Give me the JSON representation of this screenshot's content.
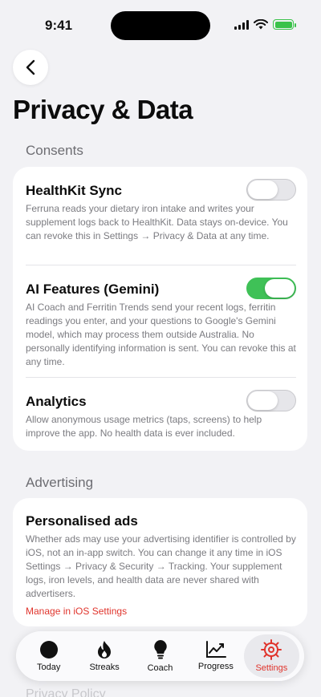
{
  "status": {
    "time": "9:41"
  },
  "title": "Privacy & Data",
  "sections": {
    "consents": {
      "header": "Consents",
      "items": [
        {
          "title": "HealthKit Sync",
          "description": "Ferruna reads your dietary iron intake and writes your supplement logs back to HealthKit. Data stays on-device. You can revoke this in Settings → Privacy & Data at any time.",
          "enabled": false
        },
        {
          "title": "AI Features (Gemini)",
          "description": "AI Coach and Ferritin Trends send your recent logs, ferritin readings you enter, and your questions to Google's Gemini model, which may process them outside Australia. No personally identifying information is sent. You can revoke this at any time.",
          "enabled": true
        },
        {
          "title": "Analytics",
          "description": "Allow anonymous usage metrics (taps, screens) to help improve the app. No health data is ever included.",
          "enabled": false
        }
      ]
    },
    "advertising": {
      "header": "Advertising",
      "title": "Personalised ads",
      "description": "Whether ads may use your advertising identifier is controlled by iOS, not an in-app switch. You can change it any time in iOS Settings → Privacy & Security → Tracking. Your supplement logs, iron levels, and health data are never shared with advertisers.",
      "link": "Manage in iOS Settings"
    },
    "privacy_policy": {
      "header": "Privacy Policy"
    }
  },
  "tabs": [
    {
      "label": "Today",
      "icon": "circle-icon",
      "active": false
    },
    {
      "label": "Streaks",
      "icon": "flame-icon",
      "active": false
    },
    {
      "label": "Coach",
      "icon": "lightbulb-icon",
      "active": false
    },
    {
      "label": "Progress",
      "icon": "chart-line-icon",
      "active": false
    },
    {
      "label": "Settings",
      "icon": "gear-icon",
      "active": true
    }
  ],
  "colors": {
    "accent": "#e0342c",
    "toggle_on": "#3fc157",
    "background": "#f2f2f5"
  }
}
